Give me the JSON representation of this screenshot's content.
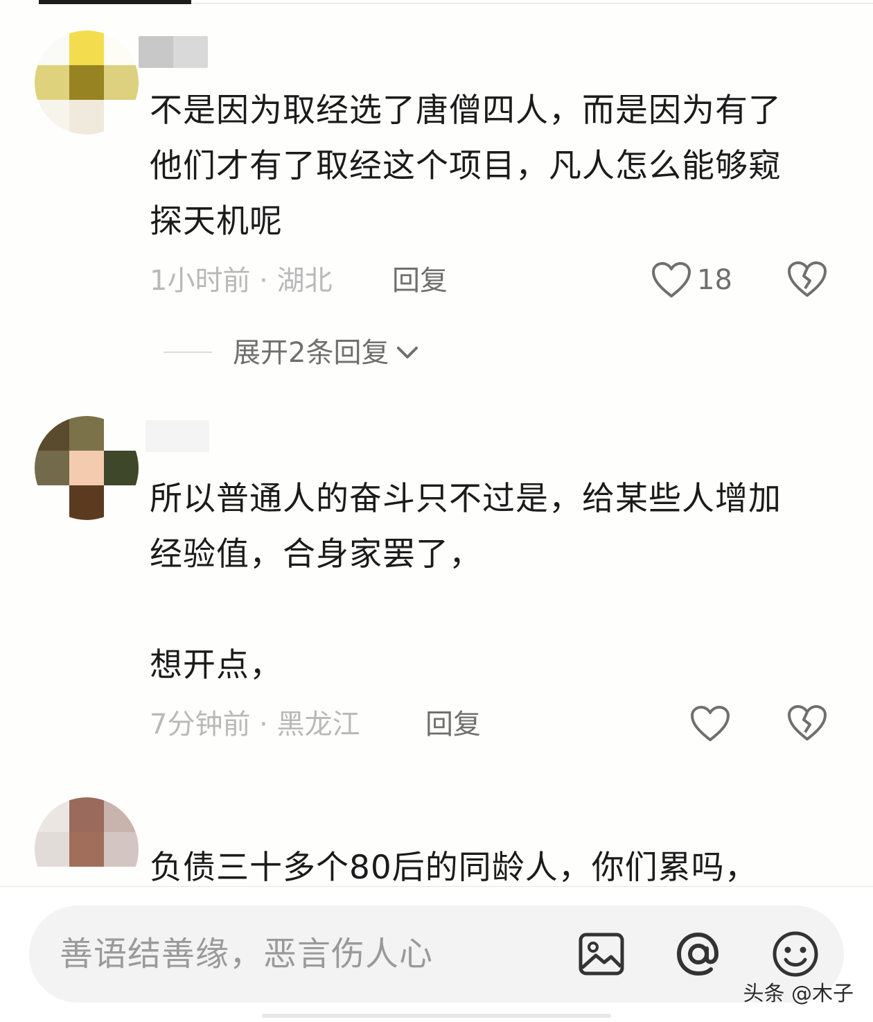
{
  "comments": [
    {
      "text": "不是因为取经选了唐僧四人，而是因为有了\n他们才有了取经这个项目，凡人怎么能够窥\n探天机呢",
      "time": "1小时前",
      "location": "湖北",
      "separator": " · ",
      "reply_label": "回复",
      "likes": "18",
      "expand_label": "展开2条回复"
    },
    {
      "text": "所以普通人的奋斗只不过是，给某些人增加\n经验值，合身家罢了，\n\n想开点，",
      "time": "7分钟前",
      "location": "黑龙江",
      "separator": " · ",
      "reply_label": "回复",
      "likes": ""
    },
    {
      "text": "负债三十多个80后的同龄人，你们累吗，"
    }
  ],
  "input": {
    "placeholder": "善语结善缘，恶言伤人心"
  },
  "icons": [
    "image-icon",
    "at-icon",
    "emoji-icon",
    "heart-icon",
    "broken-heart-icon",
    "chevron-down-icon"
  ],
  "watermark": "头条 @木子"
}
